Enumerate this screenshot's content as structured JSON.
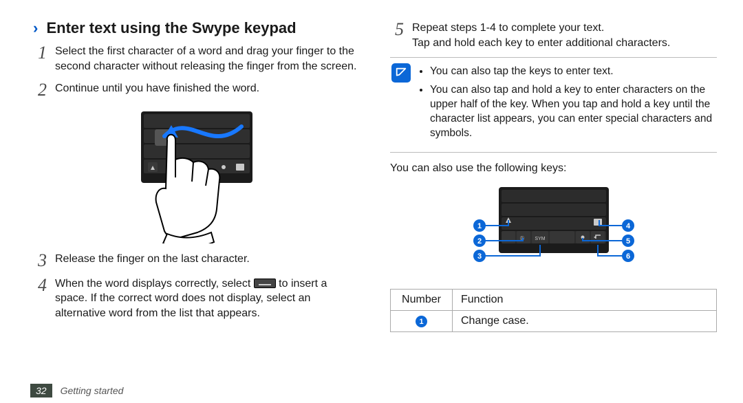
{
  "headline": "Enter text using the Swype keypad",
  "steps": {
    "s1": {
      "n": "1",
      "t": "Select the first character of a word and drag your finger to the second character without releasing the finger from the screen."
    },
    "s2": {
      "n": "2",
      "t": "Continue until you have finished the word."
    },
    "s3": {
      "n": "3",
      "t": "Release the finger on the last character."
    },
    "s4a": "When the word displays correctly, select ",
    "s4b": " to insert a space. If the correct word does not display, select an alternative word from the list that appears.",
    "s4n": "4",
    "s5": {
      "n": "5",
      "t": "Repeat steps 1-4 to complete your text."
    },
    "s5extra": "Tap and hold each key to enter additional characters."
  },
  "note": {
    "b1": "You can also tap the keys to enter text.",
    "b2": "You can also tap and hold a key to enter characters on the upper half of the key. When you tap and hold a key until the character list appears, you can enter special characters and symbols."
  },
  "after_note": "You can also use the following keys:",
  "callout_labels": {
    "c1": "1",
    "c2": "2",
    "c3": "3",
    "c4": "4",
    "c5": "5",
    "c6": "6"
  },
  "table": {
    "h1": "Number",
    "h2": "Function",
    "r1n": "1",
    "r1f": "Change case."
  },
  "footer": {
    "page": "32",
    "section": "Getting started"
  }
}
